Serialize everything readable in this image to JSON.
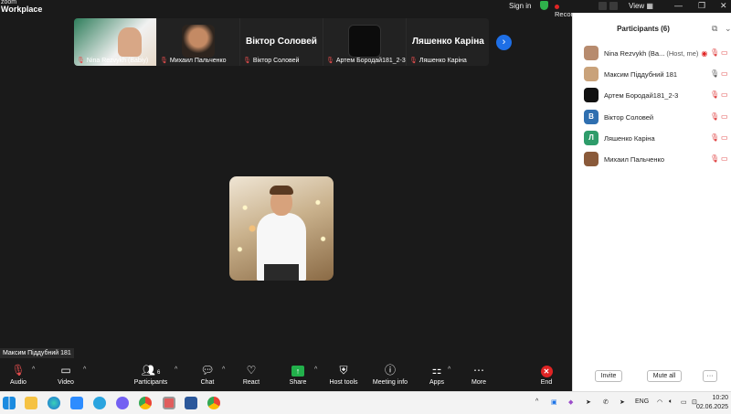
{
  "titlebar": {
    "brand_top": "zoom",
    "brand_bottom": "Workplace",
    "signin": "Sign in",
    "recording": "Recording...",
    "view": "View"
  },
  "thumbnails": [
    {
      "name": "Nina Rezvykh (Babiy)",
      "muted": true
    },
    {
      "name": "Михаил Пальченко",
      "muted": true
    },
    {
      "name": "Віктор Соловей",
      "display": "Віктор Соловей",
      "muted": true
    },
    {
      "name": "Артем Бородай181_2-3",
      "muted": true
    },
    {
      "name": "Ляшенко Каріна",
      "display": "Ляшенко Каріна",
      "muted": true
    }
  ],
  "main": {
    "active_speaker_label": "Максим Піддубний 181"
  },
  "toolbar": {
    "audio": "Audio",
    "video": "Video",
    "participants": "Participants",
    "participants_count": "6",
    "chat": "Chat",
    "react": "React",
    "share": "Share",
    "host_tools": "Host tools",
    "meeting_info": "Meeting info",
    "apps": "Apps",
    "more": "More",
    "end": "End"
  },
  "panel": {
    "title": "Participants (6)",
    "participants": [
      {
        "name": "Nina Rezvykh (Ba...",
        "suffix": "(Host, me)",
        "avatar_letter": "",
        "avatar_color": "#b78b6e",
        "mic": "muted"
      },
      {
        "name": "Максим Піддубний 181",
        "avatar_letter": "",
        "avatar_color": "#c9a27a",
        "mic": "on"
      },
      {
        "name": "Артем Бородай181_2-3",
        "avatar_letter": "",
        "avatar_color": "#111111",
        "mic": "muted"
      },
      {
        "name": "Віктор Соловей",
        "avatar_letter": "В",
        "avatar_color": "#2f6fb0",
        "mic": "muted"
      },
      {
        "name": "Ляшенко Каріна",
        "avatar_letter": "Л",
        "avatar_color": "#2e9c6a",
        "mic": "muted"
      },
      {
        "name": "Михаил Пальченко",
        "avatar_letter": "",
        "avatar_color": "#8a5a3a",
        "mic": "muted"
      }
    ],
    "invite": "Invite",
    "mute_all": "Mute all",
    "more": "···"
  },
  "taskbar": {
    "lang": "ENG",
    "time": "10:20",
    "date": "02.06.2025"
  },
  "colors": {
    "accent": "#1e6fe6",
    "danger": "#e02424",
    "share": "#22b04b"
  }
}
